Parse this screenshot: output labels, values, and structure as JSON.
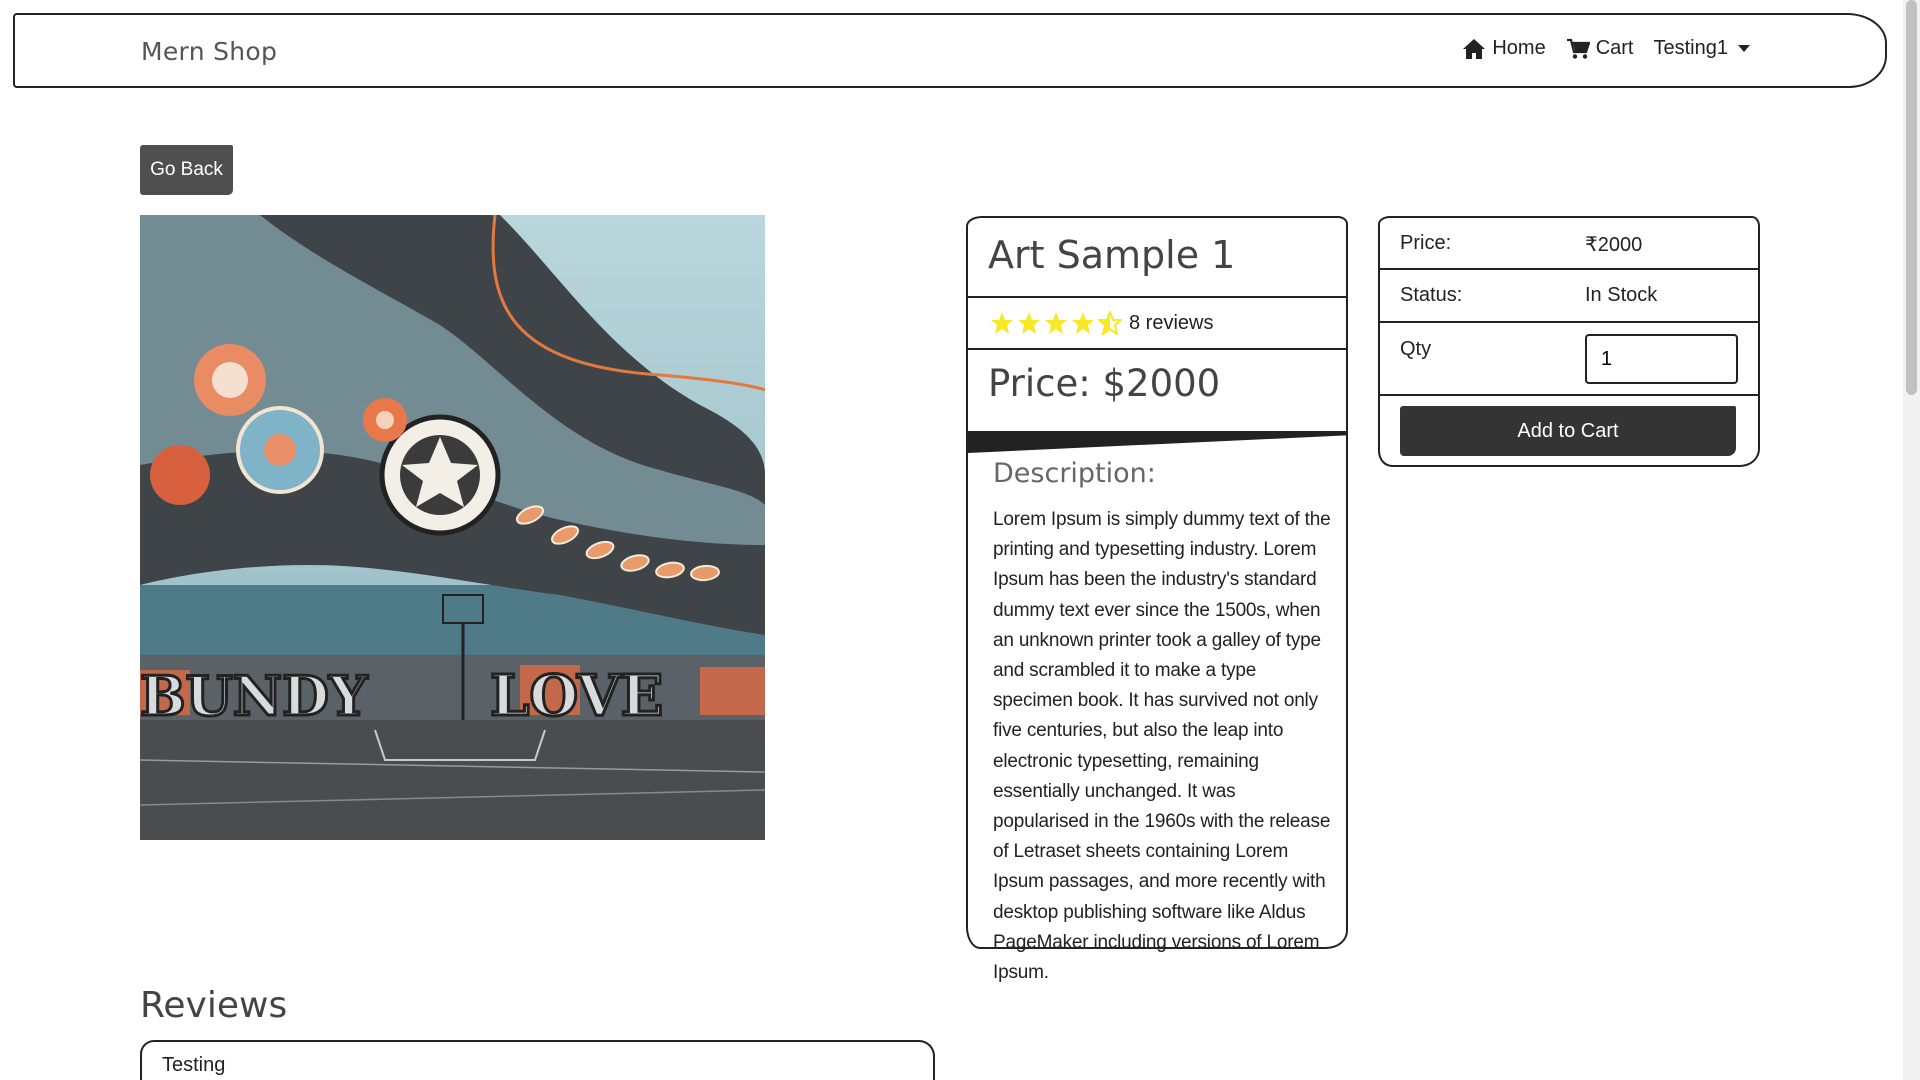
{
  "navbar": {
    "brand": "Mern Shop",
    "home_label": "Home",
    "cart_label": "Cart",
    "user_label": "Testing1"
  },
  "go_back_label": "Go Back",
  "product": {
    "name": "Art Sample 1",
    "rating": 4.5,
    "reviews_text": "8 reviews",
    "price_text": "Price: $2000",
    "description_heading": "Description:",
    "description": "Lorem Ipsum is simply dummy text of the printing and typesetting industry. Lorem Ipsum has been the industry's standard dummy text ever since the 1500s, when an unknown printer took a galley of type and scrambled it to make a type specimen book. It has survived not only five centuries, but also the leap into electronic typesetting, remaining essentially unchanged. It was popularised in the 1960s with the release of Letraset sheets containing Lorem Ipsum passages, and more recently with desktop publishing software like Aldus PageMaker including versions of Lorem Ipsum."
  },
  "buy_box": {
    "price_label": "Price:",
    "price_value": "₹2000",
    "status_label": "Status:",
    "status_value": "In Stock",
    "qty_label": "Qty",
    "qty_value": "1",
    "add_to_cart_label": "Add to Cart"
  },
  "reviews": {
    "heading": "Reviews",
    "items": [
      {
        "name": "Testing"
      }
    ]
  },
  "colors": {
    "star": "#f8e825",
    "button_dark": "#343434",
    "go_back_bg": "#4f4f4f"
  }
}
